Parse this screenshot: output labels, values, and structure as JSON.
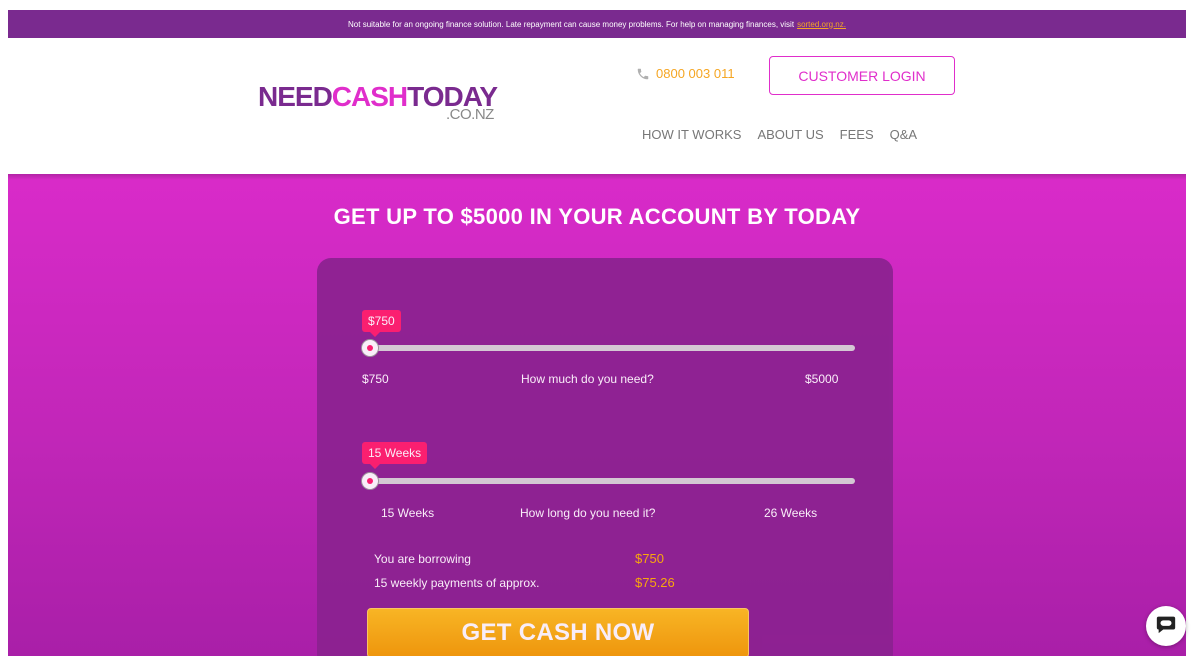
{
  "topbar": {
    "text": "Not suitable for an ongoing finance solution. Late repayment can cause money problems. For help on managing finances, visit",
    "link": "sorted.org.nz."
  },
  "header": {
    "logo": {
      "need": "NEED",
      "cash": "CASH",
      "today": "TODAY",
      "tld": ".CO.NZ"
    },
    "phone": "0800 003 011",
    "login_label": "CUSTOMER LOGIN",
    "nav": [
      "HOW IT WORKS",
      "ABOUT US",
      "FEES",
      "Q&A"
    ]
  },
  "hero": {
    "title": "GET UP TO $5000 IN YOUR ACCOUNT BY TODAY"
  },
  "calculator": {
    "amount": {
      "bubble": "$750",
      "min": "$750",
      "label": "How much do you need?",
      "max": "$5000",
      "fill": 0.0
    },
    "term": {
      "bubble": "15 Weeks",
      "min": "15 Weeks",
      "label": "How long do you need it?",
      "max": "26 Weeks",
      "fill": 0.0
    },
    "summary": {
      "borrow_label": "You are borrowing",
      "borrow_value": "$750",
      "payments_label": "15 weekly payments of approx.",
      "payments_value": "$75.26"
    },
    "cta_label": "GET CASH NOW"
  },
  "colors": {
    "accent_pink": "#e02ecb",
    "brand_purple": "#7a2a8f",
    "orange": "#f5a623",
    "bubble_red": "#ff1f6a"
  },
  "icons": {
    "phone": "phone-icon",
    "chat": "chat-icon"
  }
}
